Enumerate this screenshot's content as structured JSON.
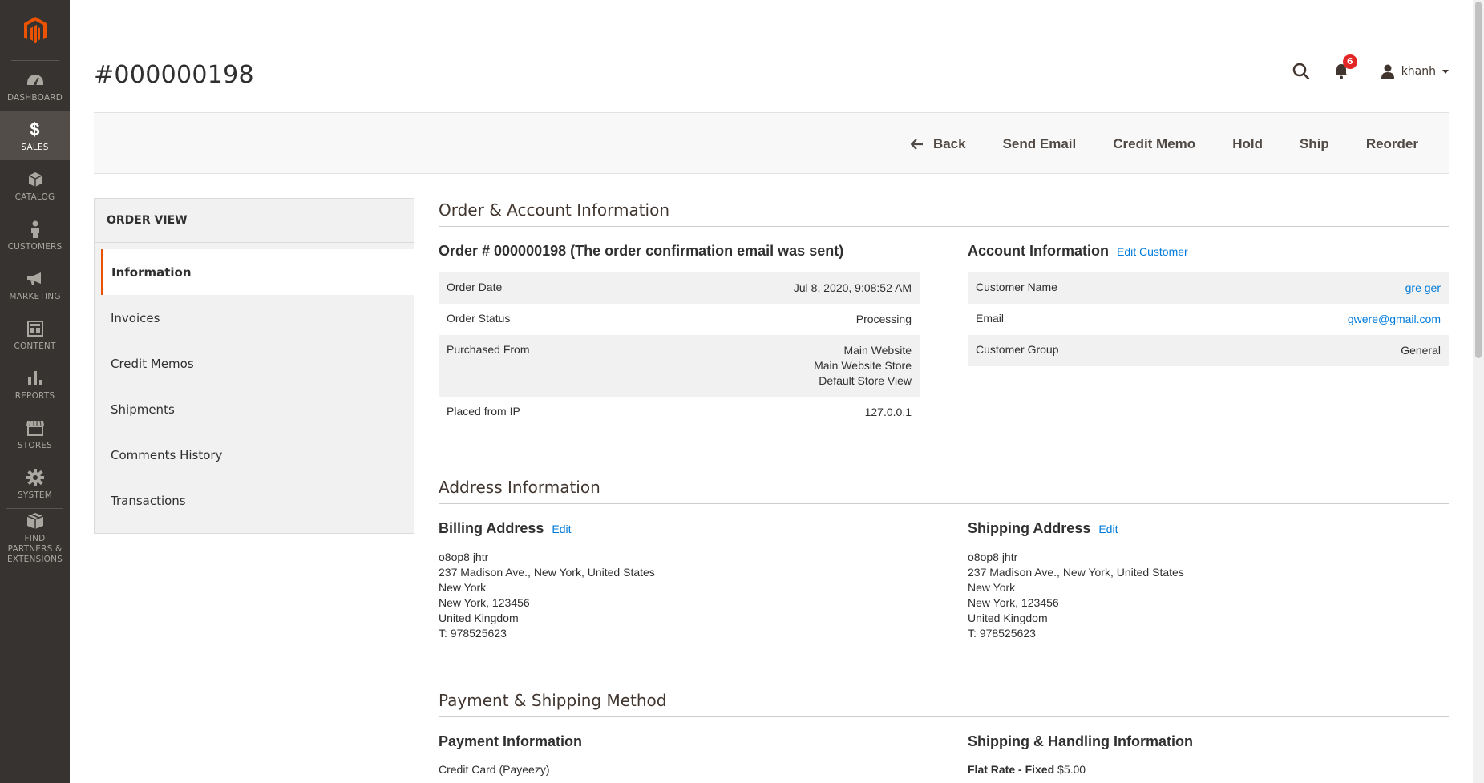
{
  "menu": {
    "items": [
      {
        "label": "DASHBOARD",
        "icon": "dashboard-icon"
      },
      {
        "label": "SALES",
        "icon": "dollar-icon"
      },
      {
        "label": "CATALOG",
        "icon": "cube-icon"
      },
      {
        "label": "CUSTOMERS",
        "icon": "person-icon"
      },
      {
        "label": "MARKETING",
        "icon": "megaphone-icon"
      },
      {
        "label": "CONTENT",
        "icon": "layout-icon"
      },
      {
        "label": "REPORTS",
        "icon": "bar-chart-icon"
      },
      {
        "label": "STORES",
        "icon": "store-icon"
      },
      {
        "label": "SYSTEM",
        "icon": "gear-icon"
      },
      {
        "label": "FIND PARTNERS & EXTENSIONS",
        "icon": "box-icon"
      }
    ],
    "active": "SALES"
  },
  "header": {
    "title": "#000000198",
    "notification_count": "6",
    "user_name": "khanh"
  },
  "actions": {
    "back": "Back",
    "send_email": "Send Email",
    "credit_memo": "Credit Memo",
    "hold": "Hold",
    "ship": "Ship",
    "reorder": "Reorder"
  },
  "sidebar": {
    "title": "ORDER VIEW",
    "tabs": [
      "Information",
      "Invoices",
      "Credit Memos",
      "Shipments",
      "Comments History",
      "Transactions"
    ],
    "active_tab": "Information"
  },
  "order_account": {
    "section_title": "Order & Account Information",
    "order_title": "Order # 000000198 (The order confirmation email was sent)",
    "order_rows": [
      {
        "label": "Order Date",
        "value": "Jul 8, 2020, 9:08:52 AM"
      },
      {
        "label": "Order Status",
        "value": "Processing"
      },
      {
        "label": "Purchased From",
        "lines": [
          "Main Website",
          "Main Website Store",
          "Default Store View"
        ]
      },
      {
        "label": "Placed from IP",
        "value": "127.0.0.1"
      }
    ],
    "account_title": "Account Information",
    "edit_customer": "Edit Customer",
    "account_rows": [
      {
        "label": "Customer Name",
        "value": "gre ger"
      },
      {
        "label": "Email",
        "value": "gwere@gmail.com"
      },
      {
        "label": "Customer Group",
        "value": "General"
      }
    ]
  },
  "address": {
    "section_title": "Address Information",
    "billing": {
      "title": "Billing Address",
      "edit": "Edit",
      "lines": [
        "o8op8 jhtr",
        "237 Madison Ave., New York, United States",
        "New York",
        "New York, 123456",
        "United Kingdom",
        "T: 978525623"
      ]
    },
    "shipping": {
      "title": "Shipping Address",
      "edit": "Edit",
      "lines": [
        "o8op8 jhtr",
        "237 Madison Ave., New York, United States",
        "New York",
        "New York, 123456",
        "United Kingdom",
        "T: 978525623"
      ]
    }
  },
  "payment": {
    "section_title": "Payment & Shipping Method",
    "payment_title": "Payment Information",
    "payment_method": "Credit Card (Payeezy)",
    "shipping_title": "Shipping & Handling Information",
    "shipping_method": "Flat Rate - Fixed",
    "shipping_price": "$5.00"
  },
  "colors": {
    "menu_bg": "#373330",
    "accent": "#eb5202",
    "link": "#007bdb",
    "badge": "#e22626"
  }
}
